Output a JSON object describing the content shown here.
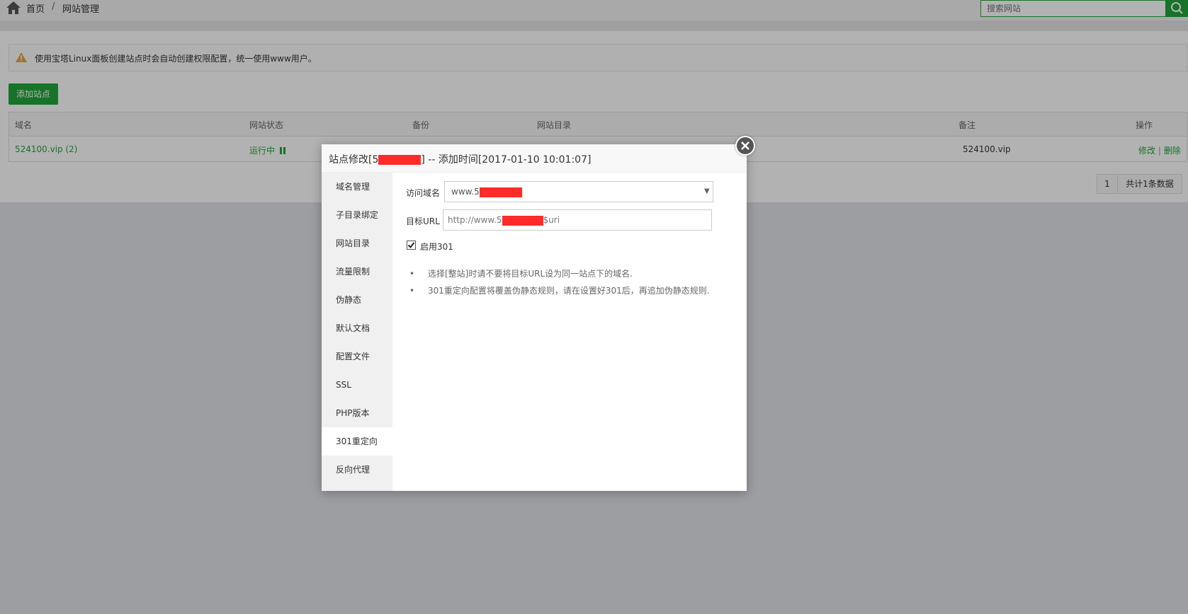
{
  "breadcrumb": {
    "home": "首页",
    "separator": "/",
    "current": "网站管理"
  },
  "search": {
    "placeholder": "搜索网站"
  },
  "notice": {
    "text": "使用宝塔Linux面板创建站点时会自动创建权限配置，统一使用www用户。"
  },
  "toolbar": {
    "add_site": "添加站点"
  },
  "table": {
    "headers": [
      "域名",
      "网站状态",
      "备份",
      "网站目录",
      "备注",
      "操作"
    ],
    "rows": [
      {
        "domain": "524100.vip (2)",
        "status": "运行中",
        "remark": "524100.vip",
        "action_edit": "修改",
        "action_sep": "|",
        "action_delete": "删除"
      }
    ]
  },
  "pagination": {
    "page": "1",
    "total": "共计1条数据"
  },
  "modal": {
    "title_prefix": "站点修改[5",
    "title_suffix": "] -- 添加时间[2017-01-10 10:01:07]",
    "nav": [
      "域名管理",
      "子目录绑定",
      "网站目录",
      "流量限制",
      "伪静态",
      "默认文档",
      "配置文件",
      "SSL",
      "PHP版本",
      "301重定向",
      "反向代理"
    ],
    "active_nav": "301重定向",
    "form": {
      "domain_label": "访问域名",
      "domain_value_prefix": "www.5",
      "target_label": "目标URL",
      "target_value_prefix": "http://www.5",
      "target_value_suffix": "$uri",
      "enable_label": "启用301",
      "enable_checked": true
    },
    "tips": [
      "选择[整站]时请不要将目标URL设为同一站点下的域名.",
      "301重定向配置将覆盖伪静态规则，请在设置好301后，再追加伪静态规则."
    ]
  },
  "colors": {
    "accent": "#20a53a",
    "redaction": "#ff2a2a"
  },
  "icons": {
    "home": "home-icon",
    "search": "search-icon",
    "warning": "warning-icon",
    "close": "close-icon",
    "status": "pause-icon"
  }
}
